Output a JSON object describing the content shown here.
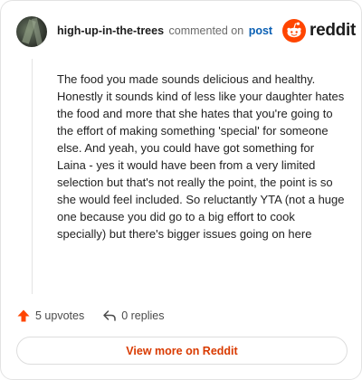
{
  "header": {
    "username": "high-up-in-the-trees",
    "commented_text": "commented on",
    "post_link": "post"
  },
  "logo": {
    "text": "reddit",
    "icon": "reddit-snoo-icon",
    "brand_color": "#ff4500"
  },
  "comment": {
    "body": "The food you made sounds delicious and healthy. Honestly it sounds kind of less like your daughter hates the food and more that she hates that you're going to the effort of making something 'special' for someone else. And yeah, you could have got something for Laina - yes it would have been from a very limited selection but that's not really the point, the point is so she would feel included. So reluctantly YTA (not a huge one because you did go to a big effort to cook specially) but there's bigger issues going on here"
  },
  "actions": {
    "upvotes": "5 upvotes",
    "upvote_icon": "upvote-arrow-icon",
    "replies": "0 replies",
    "reply_icon": "reply-arrow-icon"
  },
  "footer": {
    "view_more": "View more on Reddit",
    "accent_color": "#d93a00"
  }
}
